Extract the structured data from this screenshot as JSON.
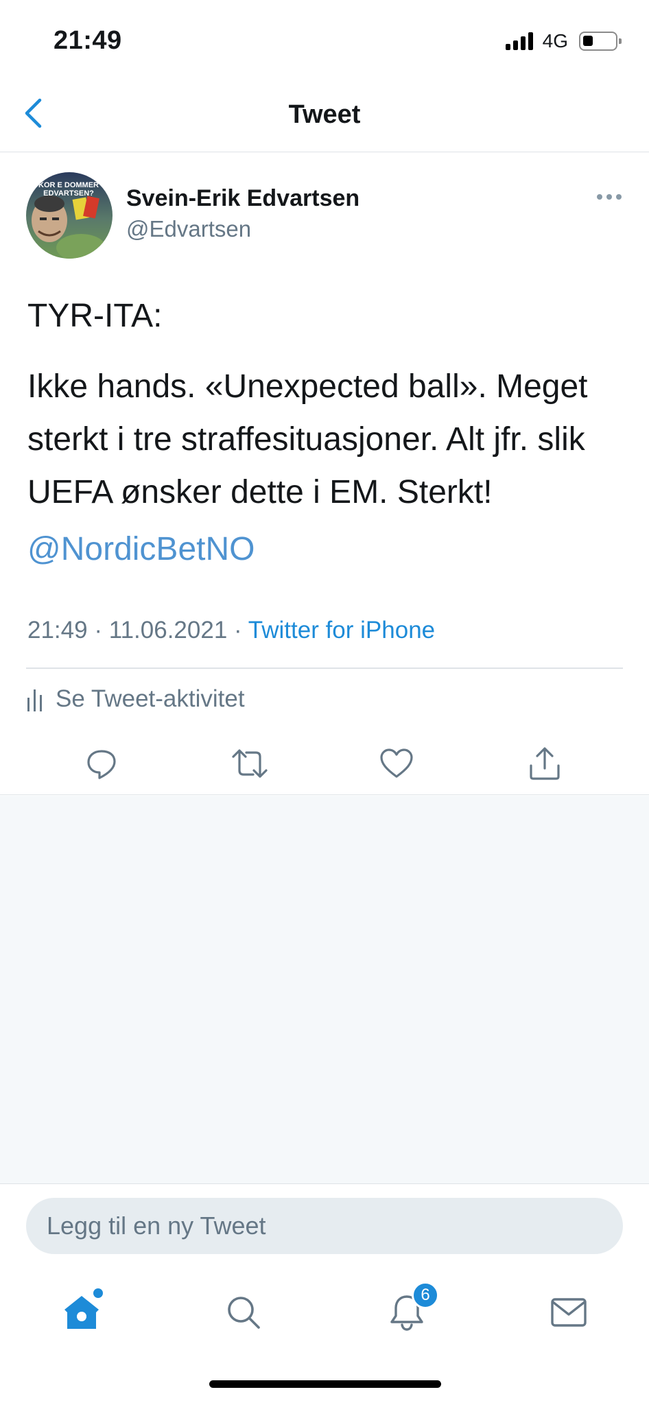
{
  "status_bar": {
    "time": "21:49",
    "network": "4G",
    "signal_bars": 4,
    "battery_level": 0.3
  },
  "header": {
    "title": "Tweet",
    "back_icon": "chevron-left-icon"
  },
  "tweet": {
    "author": {
      "name": "Svein-Erik Edvartsen",
      "handle": "@Edvartsen",
      "avatar_text": "KOR E DOMMER EDVARTSEN?"
    },
    "text_lines": [
      "TYR-ITA:"
    ],
    "body": "Ikke hands. «Unexpected ball». Meget sterkt i tre straffesituasjoner. Alt jfr. slik UEFA ønsker dette i EM. Sterkt!",
    "mention": "@NordicBetNO",
    "time": "21:49",
    "date": "11.06.2021",
    "separator": "·",
    "source": "Twitter for iPhone",
    "activity_label": "Se Tweet-aktivitet",
    "actions": [
      "reply-icon",
      "retweet-icon",
      "like-icon",
      "share-icon"
    ]
  },
  "compose": {
    "placeholder": "Legg til en ny Tweet"
  },
  "tabbar": {
    "items": [
      "home-icon",
      "search-icon",
      "notifications-icon",
      "messages-icon"
    ],
    "notifications_badge": "6"
  },
  "colors": {
    "accent": "#1d8bd8",
    "mention": "#4f93d1",
    "secondary_text": "#657786",
    "background_grey": "#f5f8fa"
  }
}
